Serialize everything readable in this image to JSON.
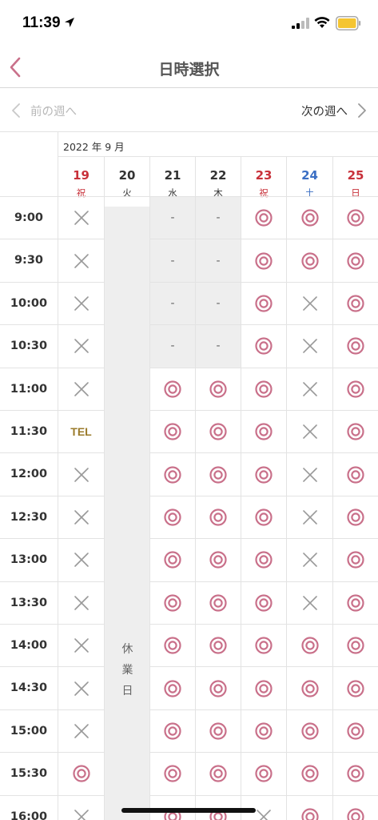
{
  "status_bar": {
    "time": "11:39",
    "icons": [
      "location-arrow-icon",
      "signal-icon",
      "wifi-icon",
      "battery-icon"
    ]
  },
  "header": {
    "title": "日時選択",
    "back_icon": "chevron-left-icon"
  },
  "week_nav": {
    "prev_label": "前の週へ",
    "next_label": "次の週へ"
  },
  "month_label": "2022 年 9 月",
  "colors": {
    "accent": "#c9708a",
    "holiday": "#c8313a",
    "saturday": "#3b6fc4",
    "text": "#333333",
    "cross": "#999999",
    "tel": "#9a7a2a",
    "closed_bg": "#eeeeee"
  },
  "days": [
    {
      "num": "19",
      "weekday": "祝",
      "color": "#c8313a"
    },
    {
      "num": "20",
      "weekday": "火",
      "color": "#333333"
    },
    {
      "num": "21",
      "weekday": "水",
      "color": "#333333"
    },
    {
      "num": "22",
      "weekday": "木",
      "color": "#333333"
    },
    {
      "num": "23",
      "weekday": "祝",
      "color": "#c8313a"
    },
    {
      "num": "24",
      "weekday": "土",
      "color": "#3b6fc4"
    },
    {
      "num": "25",
      "weekday": "日",
      "color": "#c8313a"
    }
  ],
  "closed_day_label": [
    "休",
    "業",
    "日"
  ],
  "slots": [
    {
      "time": "9:00",
      "cells": [
        "x",
        "closed",
        "-",
        "-",
        "o",
        "o",
        "o"
      ]
    },
    {
      "time": "9:30",
      "cells": [
        "x",
        "closed",
        "-",
        "-",
        "o",
        "o",
        "o"
      ]
    },
    {
      "time": "10:00",
      "cells": [
        "x",
        "closed",
        "-",
        "-",
        "o",
        "x",
        "o"
      ]
    },
    {
      "time": "10:30",
      "cells": [
        "x",
        "closed",
        "-",
        "-",
        "o",
        "x",
        "o"
      ]
    },
    {
      "time": "11:00",
      "cells": [
        "x",
        "closed",
        "o",
        "o",
        "o",
        "x",
        "o"
      ]
    },
    {
      "time": "11:30",
      "cells": [
        "TEL",
        "closed",
        "o",
        "o",
        "o",
        "x",
        "o"
      ]
    },
    {
      "time": "12:00",
      "cells": [
        "x",
        "closed",
        "o",
        "o",
        "o",
        "x",
        "o"
      ]
    },
    {
      "time": "12:30",
      "cells": [
        "x",
        "closed",
        "o",
        "o",
        "o",
        "x",
        "o"
      ]
    },
    {
      "time": "13:00",
      "cells": [
        "x",
        "closed",
        "o",
        "o",
        "o",
        "x",
        "o"
      ]
    },
    {
      "time": "13:30",
      "cells": [
        "x",
        "closed",
        "o",
        "o",
        "o",
        "x",
        "o"
      ]
    },
    {
      "time": "14:00",
      "cells": [
        "x",
        "closed",
        "o",
        "o",
        "o",
        "o",
        "o"
      ]
    },
    {
      "time": "14:30",
      "cells": [
        "x",
        "closed",
        "o",
        "o",
        "o",
        "o",
        "o"
      ]
    },
    {
      "time": "15:00",
      "cells": [
        "x",
        "closed",
        "o",
        "o",
        "o",
        "o",
        "o"
      ]
    },
    {
      "time": "15:30",
      "cells": [
        "o",
        "closed",
        "o",
        "o",
        "o",
        "o",
        "o"
      ]
    },
    {
      "time": "16:00",
      "cells": [
        "x",
        "closed",
        "o",
        "o",
        "x",
        "o",
        "o"
      ]
    }
  ]
}
